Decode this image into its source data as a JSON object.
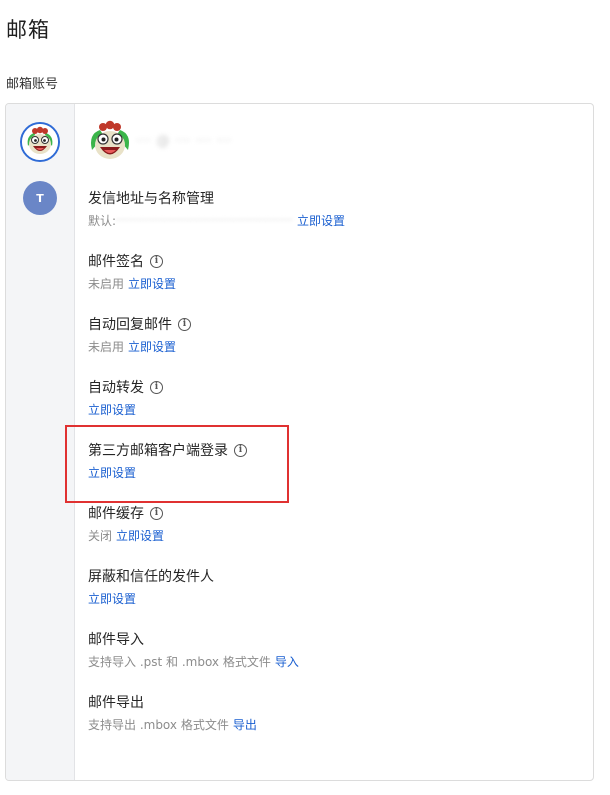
{
  "page": {
    "title": "邮箱",
    "section_title": "邮箱账号"
  },
  "sidebar": {
    "accounts": [
      {
        "type": "avatar-image",
        "name": "mascot-avatar"
      },
      {
        "type": "letter",
        "letter": "T",
        "color": "#6a86c7"
      }
    ]
  },
  "account": {
    "email": "··· @ ··· ··· ···"
  },
  "settings": [
    {
      "title": "发信地址与名称管理",
      "has_info": false,
      "status": "默认:",
      "status_value": "·········································",
      "link": "立即设置"
    },
    {
      "title": "邮件签名",
      "has_info": true,
      "status": "未启用",
      "link": "立即设置"
    },
    {
      "title": "自动回复邮件",
      "has_info": true,
      "status": "未启用",
      "link": "立即设置"
    },
    {
      "title": "自动转发",
      "has_info": true,
      "status": "",
      "link": "立即设置"
    },
    {
      "title": "第三方邮箱客户端登录",
      "has_info": true,
      "status": "",
      "link": "立即设置"
    },
    {
      "title": "邮件缓存",
      "has_info": true,
      "status": "关闭",
      "link": "立即设置"
    },
    {
      "title": "屏蔽和信任的发件人",
      "has_info": false,
      "status": "",
      "link": "立即设置"
    },
    {
      "title": "邮件导入",
      "has_info": false,
      "status": "支持导入 .pst 和 .mbox 格式文件",
      "link": "导入"
    },
    {
      "title": "邮件导出",
      "has_info": false,
      "status": "支持导出 .mbox 格式文件",
      "link": "导出"
    }
  ],
  "info_glyph": "i",
  "colors": {
    "link": "#1a5fd0",
    "highlight": "#e03131",
    "avatar_border": "#2f6bd6"
  }
}
